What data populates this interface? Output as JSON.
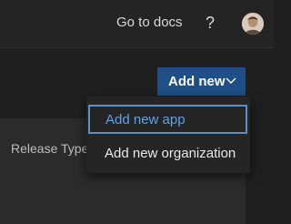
{
  "header": {
    "docs_link": "Go to docs",
    "help_label": "?",
    "avatar_icon": "user-avatar"
  },
  "toolbar": {
    "add_new_label": "Add new",
    "add_new_icon": "chevron-down-icon",
    "accent_color": "#1f4f87"
  },
  "menu": {
    "items": [
      {
        "label": "Add new app",
        "state": "focused"
      },
      {
        "label": "Add new organization",
        "state": "normal"
      }
    ]
  },
  "form": {
    "release_type_label": "Release Type:"
  }
}
